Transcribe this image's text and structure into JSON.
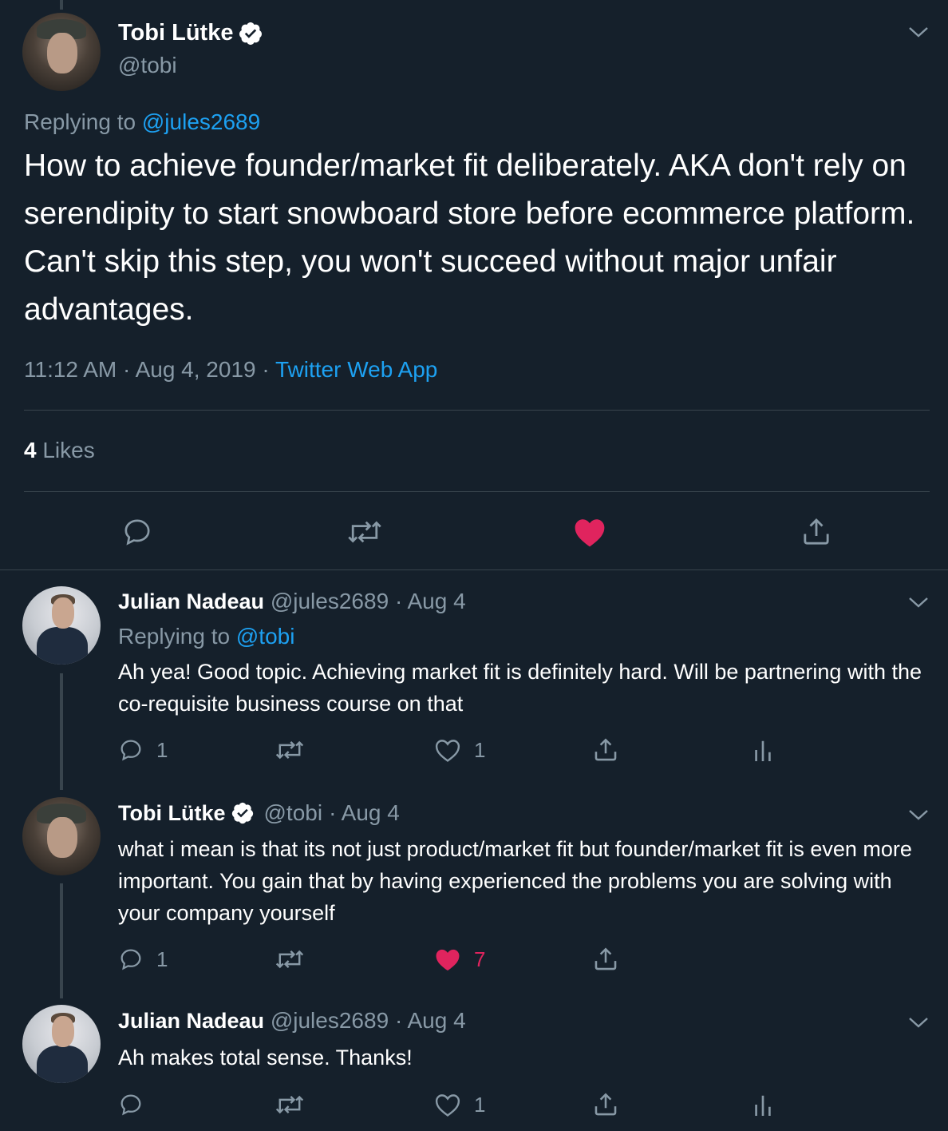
{
  "main_tweet": {
    "author_name": "Tobi Lütke",
    "author_handle": "@tobi",
    "replying_prefix": "Replying to",
    "replying_to": "@jules2689",
    "text": "How to achieve founder/market fit deliberately. AKA don't rely on serendipity to start snowboard store before ecommerce platform. Can't skip this step, you won't succeed without major unfair advantages.",
    "time": "11:12 AM",
    "date": "Aug 4, 2019",
    "separator": "·",
    "source": "Twitter Web App",
    "likes_count": "4",
    "likes_label": "Likes",
    "liked": true
  },
  "replies": [
    {
      "author_name": "Julian Nadeau",
      "author_handle": "@jules2689",
      "date": "· Aug 4",
      "replying_prefix": "Replying to",
      "replying_to": "@tobi",
      "text": "Ah yea! Good topic. Achieving market fit is definitely hard. Will be partnering with the co-requisite business course on that",
      "reply_count": "1",
      "like_count": "1"
    },
    {
      "author_name": "Tobi Lütke",
      "author_handle": "@tobi",
      "date": "· Aug 4",
      "text": "what i mean is that its not just product/market fit but founder/market fit is even more important. You gain that by having experienced the problems you are solving with your company yourself",
      "reply_count": "1",
      "like_count": "7",
      "liked": true
    },
    {
      "author_name": "Julian Nadeau",
      "author_handle": "@jules2689",
      "date": "· Aug 4",
      "text": "Ah makes total sense. Thanks!",
      "like_count": "1"
    }
  ],
  "colors": {
    "background": "#15202b",
    "muted": "#8899a6",
    "link": "#1da1f2",
    "like": "#e0245e",
    "border": "#38444d"
  }
}
